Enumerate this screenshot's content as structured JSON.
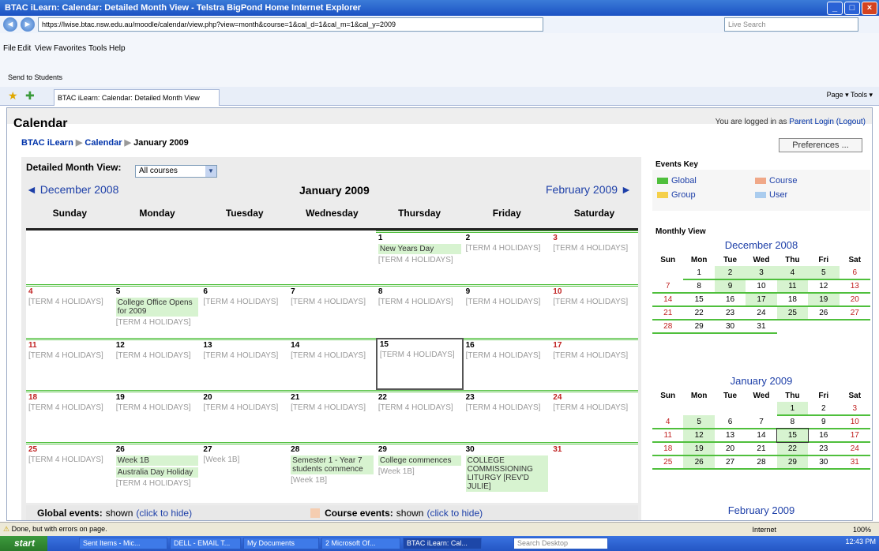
{
  "window": {
    "title": "BTAC iLearn: Calendar: Detailed Month View - Telstra BigPond Home Internet Explorer"
  },
  "browser": {
    "url": "https://lwise.btac.nsw.edu.au/moodle/calendar/view.php?view=month&course=1&cal_d=1&cal_m=1&cal_y=2009",
    "search_placeholder": "Live Search",
    "menu": [
      "File",
      "Edit",
      "View",
      "Favorites",
      "Tools",
      "Help"
    ],
    "links": "Send to Students",
    "tab": "BTAC iLearn: Calendar: Detailed Month View",
    "tools": "Page ▾  Tools ▾"
  },
  "page": {
    "title": "Calendar",
    "login_text": "You are logged in as",
    "login_user": "Parent Login",
    "logout": "(Logout)",
    "crumb": [
      "BTAC iLearn",
      "Calendar",
      "January 2009"
    ],
    "preferences": "Preferences ...",
    "detailed_month_view": "Detailed Month View:",
    "course_select": "All courses",
    "prev_month": "◄ December 2008",
    "current_month": "January 2009",
    "next_month": "February 2009 ►",
    "days": [
      "Sunday",
      "Monday",
      "Tuesday",
      "Wednesday",
      "Thursday",
      "Friday",
      "Saturday"
    ],
    "global_events": "Global events:",
    "global_shown": "shown",
    "global_hide": "(click to hide)",
    "course_events": "Course events:",
    "course_shown": "shown",
    "course_hide": "(click to hide)"
  },
  "calendar": {
    "weeks": [
      [
        {
          "d": ""
        },
        {
          "d": ""
        },
        {
          "d": ""
        },
        {
          "d": ""
        },
        {
          "d": "1",
          "events": [
            "New Years Day"
          ],
          "hol": "[TERM 4 HOLIDAYS]"
        },
        {
          "d": "2",
          "hol": "[TERM 4 HOLIDAYS]"
        },
        {
          "d": "3",
          "we": true,
          "hol": "[TERM 4 HOLIDAYS]"
        }
      ],
      [
        {
          "d": "4",
          "we": true,
          "hol": "[TERM 4 HOLIDAYS]"
        },
        {
          "d": "5",
          "events": [
            "College Office Opens for 2009"
          ],
          "hol": "[TERM 4 HOLIDAYS]"
        },
        {
          "d": "6",
          "hol": "[TERM 4 HOLIDAYS]"
        },
        {
          "d": "7",
          "hol": "[TERM 4 HOLIDAYS]"
        },
        {
          "d": "8",
          "hol": "[TERM 4 HOLIDAYS]"
        },
        {
          "d": "9",
          "hol": "[TERM 4 HOLIDAYS]"
        },
        {
          "d": "10",
          "we": true,
          "hol": "[TERM 4 HOLIDAYS]"
        }
      ],
      [
        {
          "d": "11",
          "we": true,
          "hol": "[TERM 4 HOLIDAYS]"
        },
        {
          "d": "12",
          "hol": "[TERM 4 HOLIDAYS]"
        },
        {
          "d": "13",
          "hol": "[TERM 4 HOLIDAYS]"
        },
        {
          "d": "14",
          "hol": "[TERM 4 HOLIDAYS]"
        },
        {
          "d": "15",
          "hol": "[TERM 4 HOLIDAYS]",
          "today": true
        },
        {
          "d": "16",
          "hol": "[TERM 4 HOLIDAYS]"
        },
        {
          "d": "17",
          "we": true,
          "hol": "[TERM 4 HOLIDAYS]"
        }
      ],
      [
        {
          "d": "18",
          "we": true,
          "hol": "[TERM 4 HOLIDAYS]"
        },
        {
          "d": "19",
          "hol": "[TERM 4 HOLIDAYS]"
        },
        {
          "d": "20",
          "hol": "[TERM 4 HOLIDAYS]"
        },
        {
          "d": "21",
          "hol": "[TERM 4 HOLIDAYS]"
        },
        {
          "d": "22",
          "hol": "[TERM 4 HOLIDAYS]"
        },
        {
          "d": "23",
          "hol": "[TERM 4 HOLIDAYS]"
        },
        {
          "d": "24",
          "we": true,
          "hol": "[TERM 4 HOLIDAYS]"
        }
      ],
      [
        {
          "d": "25",
          "we": true,
          "hol": "[TERM 4 HOLIDAYS]"
        },
        {
          "d": "26",
          "events": [
            "Week 1B",
            "Australia Day Holiday"
          ],
          "hol": "[TERM 4 HOLIDAYS]"
        },
        {
          "d": "27",
          "hol": "[Week 1B]"
        },
        {
          "d": "28",
          "events": [
            "Semester 1 - Year 7 students commence"
          ],
          "hol": "[Week 1B]"
        },
        {
          "d": "29",
          "events": [
            "College commences"
          ],
          "hol": "[Week 1B]"
        },
        {
          "d": "30",
          "events": [
            "COLLEGE COMMISSIONING LITURGY [REV'D JULIE]"
          ]
        },
        {
          "d": "31",
          "we": true
        }
      ]
    ]
  },
  "sidebar": {
    "events_key": "Events Key",
    "keys": [
      "Global",
      "Course",
      "Group",
      "User"
    ],
    "key_colors": [
      "#4fbf3c",
      "#f0a888",
      "#f5d04a",
      "#aaccee"
    ],
    "monthly_view": "Monthly View",
    "mini_days": [
      "Sun",
      "Mon",
      "Tue",
      "Wed",
      "Thu",
      "Fri",
      "Sat"
    ],
    "mini": [
      {
        "title": "December 2008",
        "rows": [
          [
            "",
            "1",
            "2",
            "3",
            "4",
            "5",
            "6"
          ],
          [
            "7",
            "8",
            "9",
            "10",
            "11",
            "12",
            "13"
          ],
          [
            "14",
            "15",
            "16",
            "17",
            "18",
            "19",
            "20"
          ],
          [
            "21",
            "22",
            "23",
            "24",
            "25",
            "26",
            "27"
          ],
          [
            "28",
            "29",
            "30",
            "31",
            "",
            "",
            ""
          ]
        ]
      },
      {
        "title": "January 2009",
        "rows": [
          [
            "",
            "",
            "",
            "",
            "1",
            "2",
            "3"
          ],
          [
            "4",
            "5",
            "6",
            "7",
            "8",
            "9",
            "10"
          ],
          [
            "11",
            "12",
            "13",
            "14",
            "15",
            "16",
            "17"
          ],
          [
            "18",
            "19",
            "20",
            "21",
            "22",
            "23",
            "24"
          ],
          [
            "25",
            "26",
            "27",
            "28",
            "29",
            "30",
            "31"
          ]
        ]
      },
      {
        "title": "February 2009",
        "rows": []
      }
    ]
  },
  "status": {
    "text": "Done, but with errors on page.",
    "zone": "Internet",
    "zoom": "100%"
  },
  "taskbar": {
    "start": "start",
    "items": [
      "Sent Items - Mic...",
      "DELL - EMAIL T...",
      "My Documents",
      "2 Microsoft Of...",
      "BTAC iLearn: Cal..."
    ],
    "search": "Search Desktop",
    "clock": "12:43 PM"
  }
}
